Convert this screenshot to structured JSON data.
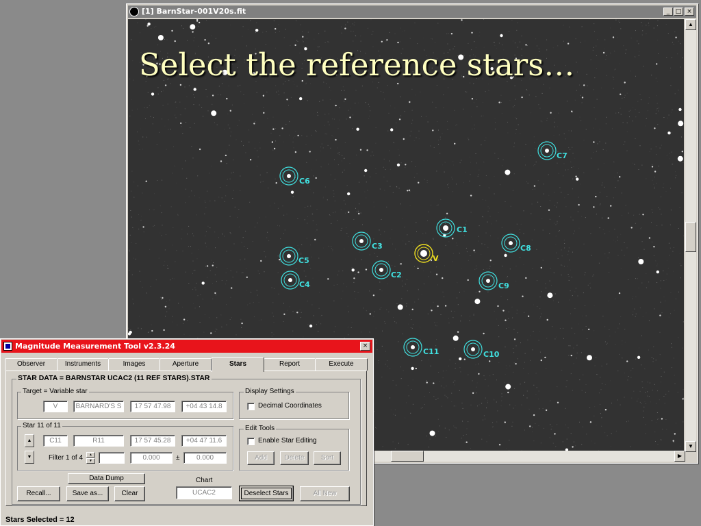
{
  "slide_title": "Select the reference stars…",
  "image_window": {
    "title": "[1] BarnStar-001V20s.fit",
    "buttons": {
      "minimize": "_",
      "maximize": "□",
      "close": "×"
    },
    "star_labels": {
      "v": "V",
      "c1": "C1",
      "c2": "C2",
      "c3": "C3",
      "c4": "C4",
      "c5": "C5",
      "c6": "C6",
      "c7": "C7",
      "c8": "C8",
      "c9": "C9",
      "c10": "C10",
      "c11": "C11"
    },
    "colors": {
      "reference_marker": "#40e0e0",
      "target_marker": "#f0e020",
      "sky": "#323232"
    }
  },
  "tool_window": {
    "title": "Magnitude Measurement Tool v2.3.24",
    "close": "×",
    "tabs": {
      "observer": "Observer",
      "instruments": "Instruments",
      "images": "Images",
      "aperture": "Aperture",
      "stars": "Stars",
      "report": "Report",
      "execute": "Execute"
    },
    "active_tab": "Stars",
    "star_data_header": "STAR DATA = BARNSTAR UCAC2 (11 REF STARS).STAR",
    "target": {
      "group_label": "Target = Variable star",
      "id": "V",
      "name": "BARNARD'S S",
      "ra": "17 57 47.98",
      "dec": "+04 43 14.8"
    },
    "display_settings": {
      "group_label": "Display Settings",
      "decimal_coordinates": "Decimal Coordinates"
    },
    "star": {
      "group_label": "Star 11 of 11",
      "id": "C11",
      "name": "R11",
      "ra": "17 57 45.28",
      "dec": "+04 47 11.6",
      "filter_label": "Filter 1 of 4",
      "filter_value": "",
      "mag": "0.000",
      "plusminus": "±",
      "err": "0.000",
      "up": "▲",
      "down": "▼"
    },
    "edit_tools": {
      "group_label": "Edit Tools",
      "enable_editing": "Enable Star Editing",
      "add": "Add",
      "delete": "Delete",
      "sort": "Sort"
    },
    "buttons": {
      "data_dump": "Data Dump",
      "recall": "Recall...",
      "save_as": "Save as...",
      "clear": "Clear",
      "chart_label": "Chart",
      "chart_value": "UCAC2",
      "deselect": "Deselect Stars",
      "all_new": "All New"
    },
    "status": "Stars Selected = 12",
    "colors": {
      "title_bar": "#e8141b"
    }
  }
}
